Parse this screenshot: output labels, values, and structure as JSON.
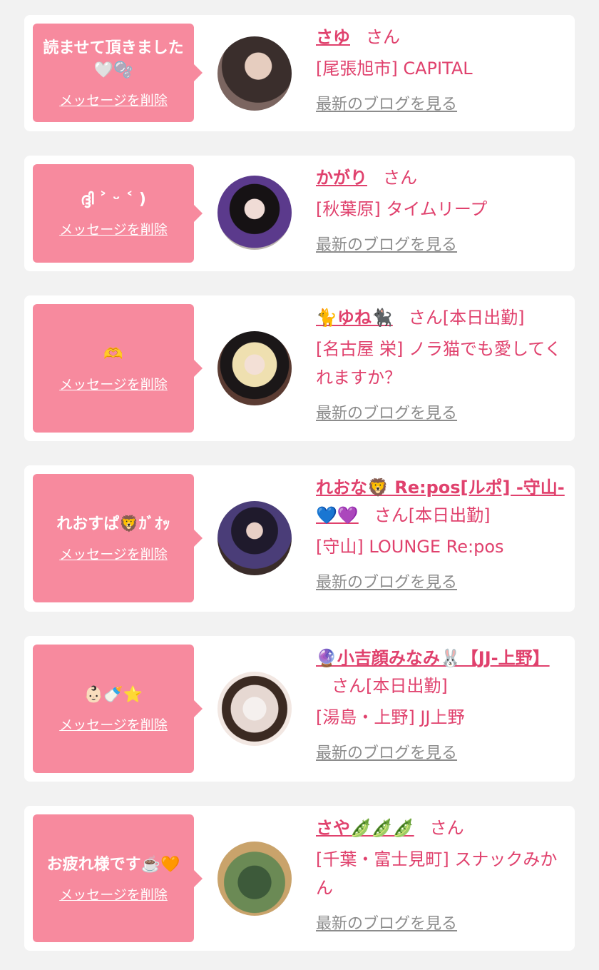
{
  "delete_label": "メッセージを削除",
  "blog_label": "最新のブログを見る",
  "honorific": "さん",
  "colors": {
    "bubble": "#f78a9e",
    "accent": "#e0416d",
    "link_gray": "#8c8c8c",
    "background": "#f2f2f2"
  },
  "entries": [
    {
      "message": "読ませて頂きました🤍🫧",
      "name": "さゆ",
      "status": "",
      "shop": "[尾張旭市] CAPITAL"
    },
    {
      "message": "ദ്ദി ˃ ᵕ ˂ )",
      "name": "かがり",
      "status": "",
      "shop": "[秋葉原] タイムリープ"
    },
    {
      "message": "🫶",
      "name": "🐈ゆね🐈‍⬛",
      "status": "[本日出勤]",
      "shop": "[名古屋 栄] ノラ猫でも愛してくれますか？"
    },
    {
      "message": "れおすぱ🦁ｶﾞｵｯ",
      "name": "れおな🦁 Re:pos[ルポ] -守山-💙💜",
      "status": "[本日出勤]",
      "shop": "[守山] LOUNGE Re:pos"
    },
    {
      "message": "👶🏻🍼⭐️",
      "name": "🔮小吉顔みなみ🐰【JJ-上野】",
      "status": "[本日出勤]",
      "shop": "[湯島・上野] JJ上野"
    },
    {
      "message": "お疲れ様です☕️🧡",
      "name": "さや🫛🫛🫛",
      "status": "",
      "shop": "[千葉・富士見町] スナックみかん"
    }
  ]
}
